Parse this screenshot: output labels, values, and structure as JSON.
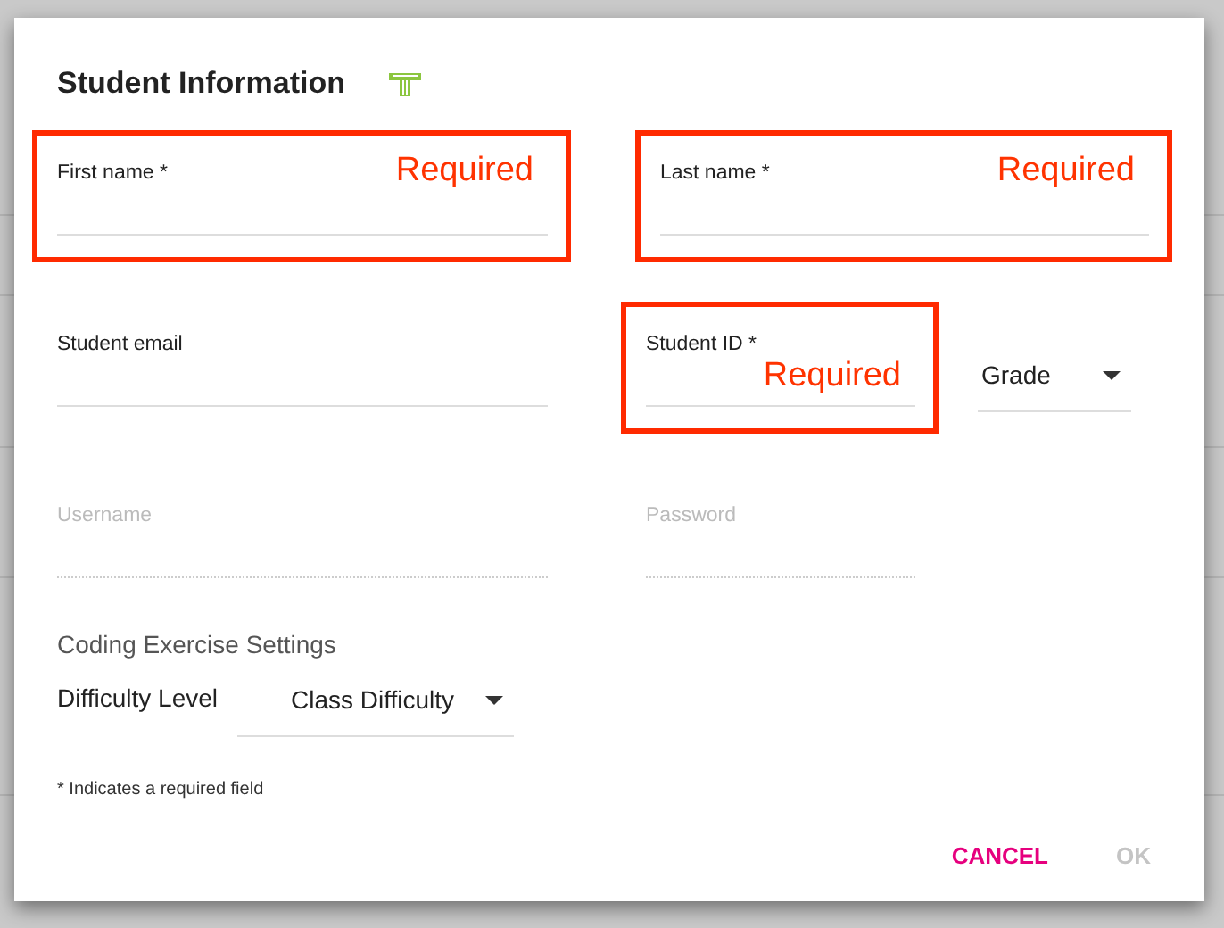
{
  "dialog": {
    "title": "Student Information"
  },
  "fields": [
    {
      "label": "First name *",
      "disabled": false,
      "annotation": "Required"
    },
    {
      "label": "Last name *",
      "disabled": false,
      "annotation": "Required"
    },
    {
      "label": "Student email",
      "disabled": false
    },
    {
      "label": "Student ID *",
      "disabled": false,
      "annotation": "Required"
    },
    {
      "label": "Username",
      "disabled": true
    },
    {
      "label": "Password",
      "disabled": true
    }
  ],
  "grade_select": {
    "value": "Grade"
  },
  "coding_settings": {
    "heading": "Coding Exercise Settings",
    "label": "Difficulty Level",
    "value": "Class Difficulty"
  },
  "footnote": "* Indicates a required field",
  "buttons": [
    {
      "label": "CANCEL",
      "disabled": false
    },
    {
      "label": "OK",
      "disabled": true
    }
  ]
}
